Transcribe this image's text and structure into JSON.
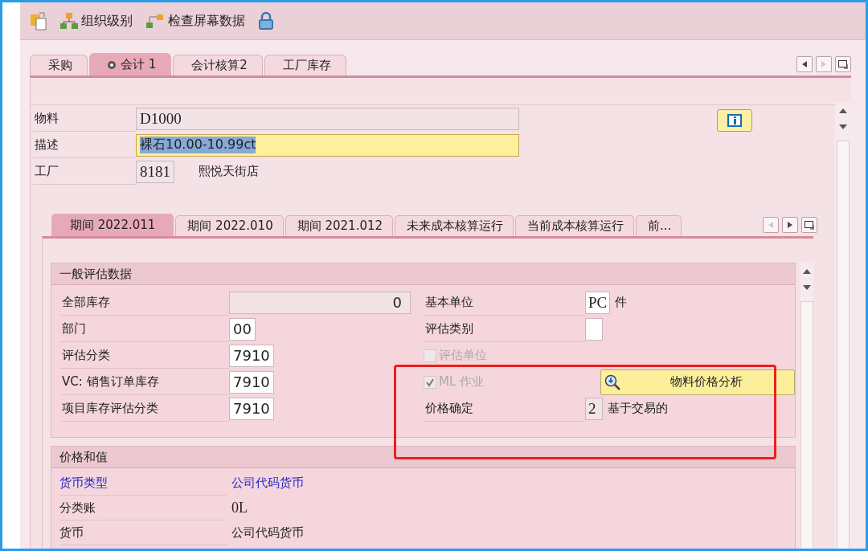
{
  "toolbar": [
    {
      "kind": "copy"
    },
    {
      "kind": "org",
      "label": "组织级别"
    },
    {
      "kind": "check",
      "label": "检查屏幕数据"
    },
    {
      "kind": "lock"
    }
  ],
  "tabs": [
    {
      "label": "采购",
      "selected": false
    },
    {
      "label": "会计 1",
      "selected": true
    },
    {
      "label": "会计核算2",
      "selected": false
    },
    {
      "label": "工厂库存",
      "selected": false
    }
  ],
  "header": {
    "material": {
      "label": "物料",
      "value": "D1000"
    },
    "description": {
      "label": "描述",
      "value": "裸石10.00-10.99ct"
    },
    "plant": {
      "label": "工厂",
      "value": "8181",
      "text": "熙悦天街店"
    }
  },
  "period_tabs": [
    {
      "label": "期间 2022.011",
      "selected": true
    },
    {
      "label": "期间 2022.010",
      "selected": false
    },
    {
      "label": "期间 2021.012",
      "selected": false
    },
    {
      "label": "未来成本核算运行",
      "selected": false
    },
    {
      "label": "当前成本核算运行",
      "selected": false
    },
    {
      "label": "前...",
      "selected": false
    }
  ],
  "general": {
    "title": "一般评估数据",
    "left": [
      {
        "label": "全部库存",
        "value": "0",
        "kind": "readonly"
      },
      {
        "label": "部门",
        "value": "00",
        "kind": "input"
      },
      {
        "label": "评估分类",
        "value": "7910",
        "kind": "input"
      },
      {
        "label": "VC: 销售订单库存",
        "value": "7910",
        "kind": "input"
      },
      {
        "label": "项目库存评估分类",
        "value": "7910",
        "kind": "input"
      }
    ],
    "right": [
      {
        "kind": "field",
        "label": "基本单位",
        "value": "PC",
        "text": "件"
      },
      {
        "kind": "field",
        "label": "评估类别"
      },
      {
        "kind": "checkbox",
        "label": "评估单位",
        "checked": false,
        "disabled": true
      },
      {
        "kind": "checkbox",
        "label": "ML 作业",
        "checked": true,
        "disabled": true,
        "action": "物料价格分析"
      },
      {
        "kind": "readonly",
        "label": "价格确定",
        "value": "2",
        "text": "基于交易的"
      }
    ]
  },
  "prices": {
    "title": "价格和值",
    "rows": [
      {
        "label": "货币类型",
        "value": "公司代码货币",
        "link": true,
        "kind": "text"
      },
      {
        "label": "分类账",
        "value": "0L",
        "link": false,
        "kind": "code"
      },
      {
        "label": "货币",
        "value": "公司代码货币",
        "link": false,
        "kind": "text"
      }
    ]
  }
}
